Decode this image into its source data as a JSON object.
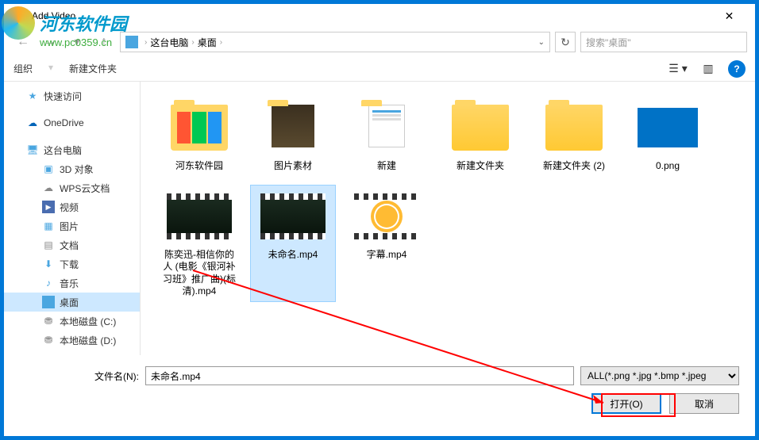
{
  "window": {
    "title": "Add Video"
  },
  "breadcrumb": {
    "items": [
      "这台电脑",
      "桌面"
    ]
  },
  "search": {
    "placeholder": "搜索\"桌面\""
  },
  "toolbar2": {
    "organize": "组织",
    "new_folder": "新建文件夹"
  },
  "sidebar": {
    "items": [
      {
        "label": "快速访问",
        "icon": "star"
      },
      {
        "label": "OneDrive",
        "icon": "cloud-blue"
      },
      {
        "label": "这台电脑",
        "icon": "pc"
      },
      {
        "label": "3D 对象",
        "icon": "cube",
        "indent": true
      },
      {
        "label": "WPS云文档",
        "icon": "cloud-gray",
        "indent": true
      },
      {
        "label": "视频",
        "icon": "video",
        "indent": true
      },
      {
        "label": "图片",
        "icon": "image",
        "indent": true
      },
      {
        "label": "文档",
        "icon": "doc",
        "indent": true
      },
      {
        "label": "下载",
        "icon": "download",
        "indent": true
      },
      {
        "label": "音乐",
        "icon": "music",
        "indent": true
      },
      {
        "label": "桌面",
        "icon": "desktop",
        "indent": true,
        "selected": true
      },
      {
        "label": "本地磁盘 (C:)",
        "icon": "disk",
        "indent": true
      },
      {
        "label": "本地磁盘 (D:)",
        "icon": "disk",
        "indent": true
      }
    ]
  },
  "files": {
    "items": [
      {
        "label": "河东软件园",
        "type": "folder-apps"
      },
      {
        "label": "图片素材",
        "type": "folder-img"
      },
      {
        "label": "新建",
        "type": "folder-doc"
      },
      {
        "label": "新建文件夹",
        "type": "folder"
      },
      {
        "label": "新建文件夹 (2)",
        "type": "folder"
      },
      {
        "label": "0.png",
        "type": "image-blue"
      },
      {
        "label": "陈奕迅-相信你的人 (电影《银河补习班》推广曲)(标清).mp4",
        "type": "video-dark"
      },
      {
        "label": "未命名.mp4",
        "type": "video-dark",
        "selected": true
      },
      {
        "label": "字幕.mp4",
        "type": "video-sun"
      }
    ]
  },
  "footer": {
    "filename_label": "文件名(N):",
    "filename_value": "未命名.mp4",
    "filetype": "ALL(*.png *.jpg *.bmp *.jpeg",
    "open_btn": "打开(O)",
    "cancel_btn": "取消"
  },
  "watermark": {
    "text": "河东软件园",
    "url": "www.pc0359.cn"
  }
}
